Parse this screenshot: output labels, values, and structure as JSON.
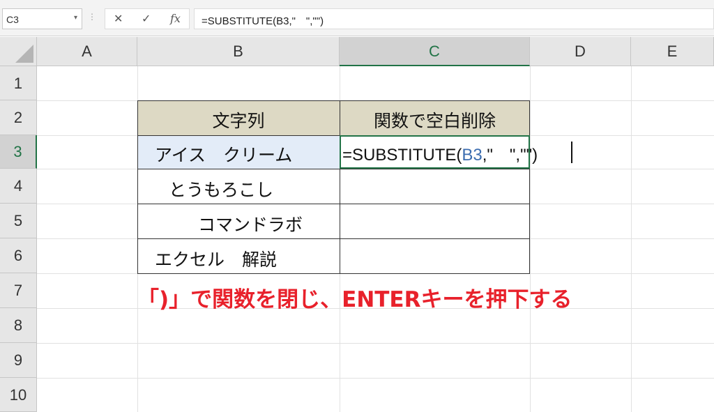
{
  "formula_bar": {
    "name_box": "C3",
    "name_box_arrow": "▾",
    "dots": "⋮",
    "cancel_icon": "✕",
    "enter_icon": "✓",
    "fx_label": "fx",
    "formula": "=SUBSTITUTE(B3,\"　\",\"\")"
  },
  "columns": [
    "A",
    "B",
    "C",
    "D",
    "E"
  ],
  "active_column": "C",
  "rows": [
    "1",
    "2",
    "3",
    "4",
    "5",
    "6",
    "7",
    "8",
    "9",
    "10"
  ],
  "active_row": "3",
  "table": {
    "header_b": "文字列",
    "header_c": "関数で空白削除",
    "b3": "アイス　クリーム",
    "b4": "とうもろこし",
    "b5": "コマンドラボ",
    "b6": "エクセル　解説"
  },
  "editing_cell": {
    "prefix": "=SUBSTITUTE(",
    "ref": "B3",
    "suffix": ",\"　\",\"\")"
  },
  "annotation": "「)」で関数を閉じ、ENTERキーを押下する",
  "colors": {
    "accent": "#217346",
    "header_fill": "#ddd9c4",
    "selection_fill": "#e3ecf8",
    "annotation": "#e8212b",
    "reference": "#3c6db0"
  }
}
